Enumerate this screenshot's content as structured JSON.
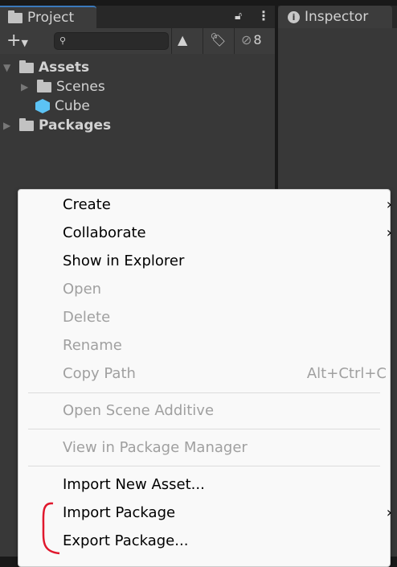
{
  "project_tab": {
    "label": "Project"
  },
  "inspector_tab": {
    "label": "Inspector"
  },
  "toolbar": {
    "hidden_count": "8",
    "search_placeholder": ""
  },
  "tree": [
    {
      "label": "Assets"
    },
    {
      "label": "Scenes"
    },
    {
      "label": "Cube"
    },
    {
      "label": "Packages"
    }
  ],
  "menu": {
    "items": [
      {
        "label": "Create",
        "submenu": true
      },
      {
        "label": "Collaborate",
        "submenu": true
      },
      {
        "label": "Show in Explorer"
      },
      {
        "label": "Open",
        "disabled": true
      },
      {
        "label": "Delete",
        "disabled": true
      },
      {
        "label": "Rename",
        "disabled": true
      },
      {
        "label": "Copy Path",
        "disabled": true,
        "shortcut": "Alt+Ctrl+C"
      },
      {
        "label": "Open Scene Additive",
        "disabled": true
      },
      {
        "label": "View in Package Manager",
        "disabled": true
      },
      {
        "label": "Import New Asset..."
      },
      {
        "label": "Import Package",
        "submenu": true
      },
      {
        "label": "Export Package..."
      }
    ]
  },
  "colors": {
    "accent": "#3a79bb",
    "annotation": "#e0182d",
    "cube": "#5cc3f5"
  }
}
